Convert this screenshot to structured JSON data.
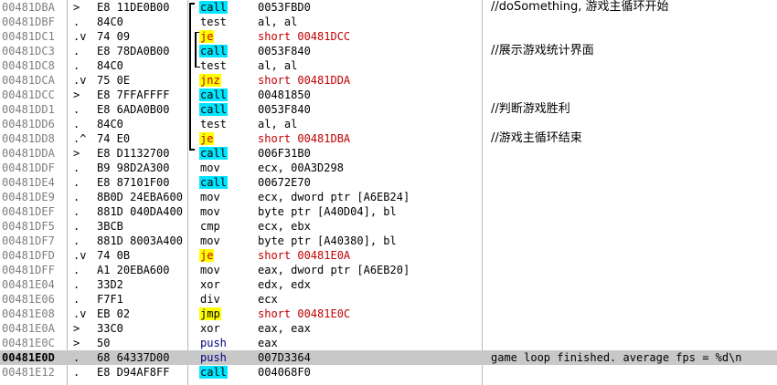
{
  "disassembly": {
    "rows": [
      {
        "addr": "00481DBA",
        "mark": ">",
        "hex": "E8 11DE0B00",
        "mnemonic": "call",
        "ops": "0053FBD0",
        "comment": "//doSomething, 游戏主循环开始",
        "kind": "call"
      },
      {
        "addr": "00481DBF",
        "mark": ".",
        "hex": "84C0",
        "mnemonic": "test",
        "ops": "al, al",
        "comment": "",
        "kind": "plain"
      },
      {
        "addr": "00481DC1",
        "mark": ".v",
        "hex": "74 09",
        "mnemonic": "je",
        "ops": "short 00481DCC",
        "comment": "",
        "kind": "jcc"
      },
      {
        "addr": "00481DC3",
        "mark": ".",
        "hex": "E8 78DA0B00",
        "mnemonic": "call",
        "ops": "0053F840",
        "comment": "//展示游戏统计界面",
        "kind": "call"
      },
      {
        "addr": "00481DC8",
        "mark": ".",
        "hex": "84C0",
        "mnemonic": "test",
        "ops": "al, al",
        "comment": "",
        "kind": "plain"
      },
      {
        "addr": "00481DCA",
        "mark": ".v",
        "hex": "75 0E",
        "mnemonic": "jnz",
        "ops": "short 00481DDA",
        "comment": "",
        "kind": "jcc"
      },
      {
        "addr": "00481DCC",
        "mark": ">",
        "hex": "E8 7FFAFFFF",
        "mnemonic": "call",
        "ops": "00481850",
        "comment": "",
        "kind": "call"
      },
      {
        "addr": "00481DD1",
        "mark": ".",
        "hex": "E8 6ADA0B00",
        "mnemonic": "call",
        "ops": "0053F840",
        "comment": "//判断游戏胜利",
        "kind": "call"
      },
      {
        "addr": "00481DD6",
        "mark": ".",
        "hex": "84C0",
        "mnemonic": "test",
        "ops": "al, al",
        "comment": "",
        "kind": "plain"
      },
      {
        "addr": "00481DD8",
        "mark": ".^",
        "hex": "74 E0",
        "mnemonic": "je",
        "ops": "short 00481DBA",
        "comment": "//游戏主循环结束",
        "kind": "jcc"
      },
      {
        "addr": "00481DDA",
        "mark": ">",
        "hex": "E8 D1132700",
        "mnemonic": "call",
        "ops": "006F31B0",
        "comment": "",
        "kind": "call"
      },
      {
        "addr": "00481DDF",
        "mark": ".",
        "hex": "B9 98D2A300",
        "mnemonic": "mov",
        "ops": "ecx, 00A3D298",
        "comment": "",
        "kind": "plain"
      },
      {
        "addr": "00481DE4",
        "mark": ".",
        "hex": "E8 87101F00",
        "mnemonic": "call",
        "ops": "00672E70",
        "comment": "",
        "kind": "call"
      },
      {
        "addr": "00481DE9",
        "mark": ".",
        "hex": "8B0D 24EBA600",
        "mnemonic": "mov",
        "ops": "ecx, dword ptr [A6EB24]",
        "comment": "",
        "kind": "plain"
      },
      {
        "addr": "00481DEF",
        "mark": ".",
        "hex": "881D 040DA400",
        "mnemonic": "mov",
        "ops": "byte ptr [A40D04], bl",
        "comment": "",
        "kind": "plain"
      },
      {
        "addr": "00481DF5",
        "mark": ".",
        "hex": "3BCB",
        "mnemonic": "cmp",
        "ops": "ecx, ebx",
        "comment": "",
        "kind": "plain"
      },
      {
        "addr": "00481DF7",
        "mark": ".",
        "hex": "881D 8003A400",
        "mnemonic": "mov",
        "ops": "byte ptr [A40380], bl",
        "comment": "",
        "kind": "plain"
      },
      {
        "addr": "00481DFD",
        "mark": ".v",
        "hex": "74 0B",
        "mnemonic": "je",
        "ops": "short 00481E0A",
        "comment": "",
        "kind": "jcc"
      },
      {
        "addr": "00481DFF",
        "mark": ".",
        "hex": "A1 20EBA600",
        "mnemonic": "mov",
        "ops": "eax, dword ptr [A6EB20]",
        "comment": "",
        "kind": "plain"
      },
      {
        "addr": "00481E04",
        "mark": ".",
        "hex": "33D2",
        "mnemonic": "xor",
        "ops": "edx, edx",
        "comment": "",
        "kind": "plain"
      },
      {
        "addr": "00481E06",
        "mark": ".",
        "hex": "F7F1",
        "mnemonic": "div",
        "ops": "ecx",
        "comment": "",
        "kind": "plain"
      },
      {
        "addr": "00481E08",
        "mark": ".v",
        "hex": "EB 02",
        "mnemonic": "jmp",
        "ops": "short 00481E0C",
        "comment": "",
        "kind": "jmp"
      },
      {
        "addr": "00481E0A",
        "mark": ">",
        "hex": "33C0",
        "mnemonic": "xor",
        "ops": "eax, eax",
        "comment": "",
        "kind": "plain"
      },
      {
        "addr": "00481E0C",
        "mark": ">",
        "hex": "50",
        "mnemonic": "push",
        "ops": "eax",
        "comment": "",
        "kind": "push"
      },
      {
        "addr": "00481E0D",
        "mark": ".",
        "hex": "68 64337D00",
        "mnemonic": "push",
        "ops": "007D3364",
        "comment": "game loop finished. average fps = %d\\n",
        "kind": "push",
        "selected": true
      },
      {
        "addr": "00481E12",
        "mark": ".",
        "hex": "E8 D94AF8FF",
        "mnemonic": "call",
        "ops": "004068F0",
        "comment": "",
        "kind": "call"
      }
    ]
  }
}
